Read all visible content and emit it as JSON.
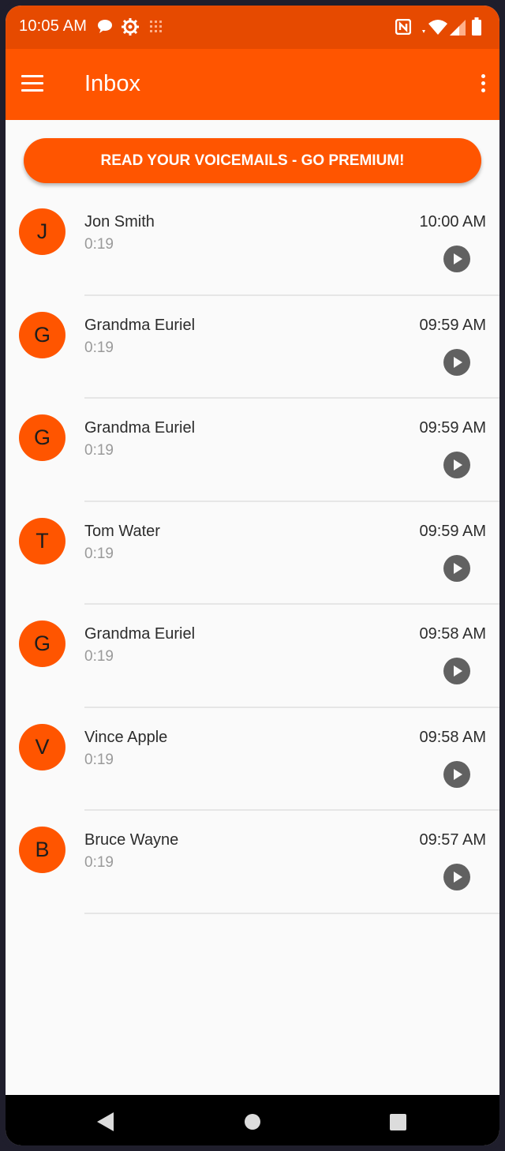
{
  "status_bar": {
    "time": "10:05 AM",
    "icons": [
      "chat-bubble-icon",
      "gear-icon",
      "grid-icon",
      "nfc-icon",
      "wifi-icon",
      "signal-icon",
      "battery-icon"
    ]
  },
  "app_bar": {
    "title": "Inbox",
    "menu_icon": "hamburger-menu-icon",
    "more_icon": "more-vert-icon"
  },
  "premium_button": {
    "label": "READ YOUR VOICEMAILS - GO PREMIUM!"
  },
  "voicemails": [
    {
      "initial": "J",
      "name": "Jon Smith",
      "duration": "0:19",
      "time": "10:00 AM"
    },
    {
      "initial": "G",
      "name": "Grandma Euriel",
      "duration": "0:19",
      "time": "09:59 AM"
    },
    {
      "initial": "G",
      "name": "Grandma Euriel",
      "duration": "0:19",
      "time": "09:59 AM"
    },
    {
      "initial": "T",
      "name": "Tom Water",
      "duration": "0:19",
      "time": "09:59 AM"
    },
    {
      "initial": "G",
      "name": "Grandma Euriel",
      "duration": "0:19",
      "time": "09:58 AM"
    },
    {
      "initial": "V",
      "name": "Vince Apple",
      "duration": "0:19",
      "time": "09:58 AM"
    },
    {
      "initial": "B",
      "name": "Bruce Wayne",
      "duration": "0:19",
      "time": "09:57 AM"
    }
  ],
  "colors": {
    "accent": "#ff5500",
    "status_bar": "#e64a00",
    "play_button": "#616161",
    "background": "#fafafa"
  }
}
